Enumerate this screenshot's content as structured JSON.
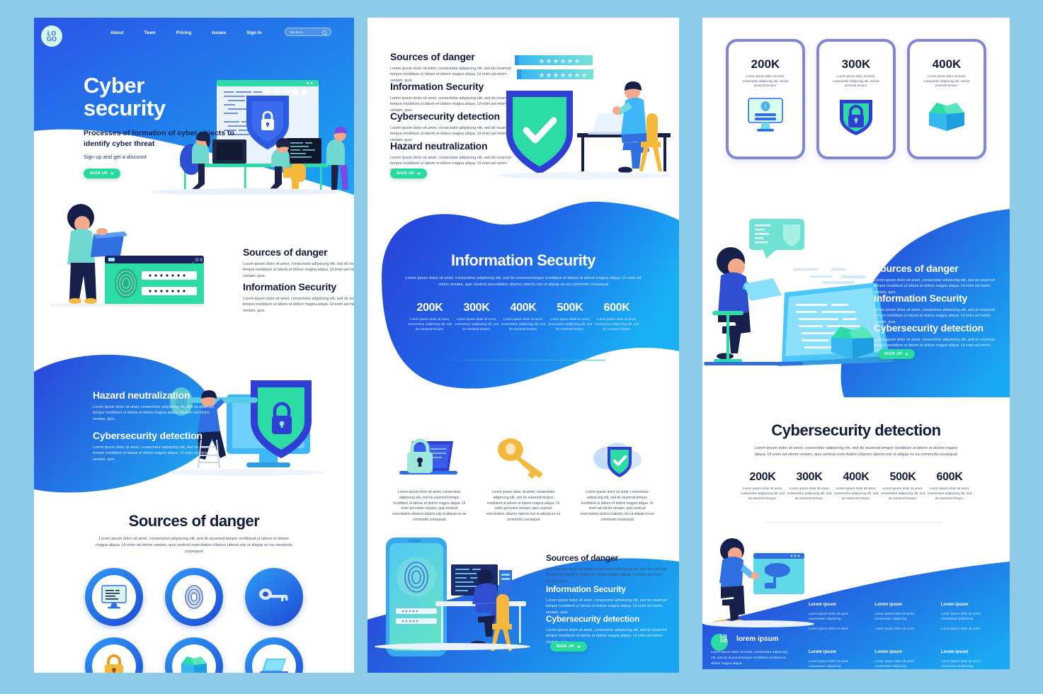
{
  "meta": {
    "background_color": "#8ecbe8",
    "accent_blue": "#1f49d6",
    "accent_cyan": "#18a8f0",
    "accent_green": "#27dba0",
    "text_dark": "#141c3a"
  },
  "lorem": {
    "short": "Lorem ipsum dolor sit amet, consectetur adipiscing elit, sed do eiusmod tempor incididunt ut labore et dolore magna aliqua. Ut enim ad minim veniam, quis.",
    "long": "Lorem ipsum dolor sit amet, consectetur adipiscing elit, sed do eiusmod tempor incididunt ut labore et dolore magna aliqua. Ut enim ad minim veniam, quis nostrud exercitation ullamco laboris nisi ut aliquip ex ea commodo consequat",
    "tiny": "Lorem ipsum dolor sit amet, consectetur adipiscing elit, sed do eiusmod tempor.",
    "icon_caption": "Lorem ipsum dolor sit amet, consectetur adipiscing elit, sed do eiusmod tempor incididunt ut labore et dolore magna aliqua. Ut enim ad minim veniam, quis nostrud exercitation ullamco laboris nisi ut aliquip ex ea commodo consequat",
    "footer_heading": "Lorem ipsum",
    "footer_line_1": "Lorem ipsum dolor sit amet, consectetur adipiscing",
    "footer_line_2": "Lorem ipsum dolor sit amet",
    "brand_tagline": "lorem ipsum",
    "brand_body": "Lorem ipsum dolor sit amet, consectetur adipiscing elit, sed do eiusmod tempor incididunt ut labore et dolore magna aliqua."
  },
  "panel1": {
    "nav": {
      "logo_line1": "LO",
      "logo_line2": "GO",
      "links": [
        "About",
        "Team",
        "Pricing",
        "Issues",
        "Sign In"
      ],
      "search_value": "Get More",
      "search_icon": "search-icon"
    },
    "hero": {
      "title_line1": "Cyber",
      "title_line2": "security",
      "subtitle": "Processes of formation of cyber objects to identify cyber threat",
      "note": "Sign up and get a discount",
      "cta": "SIGN UP"
    },
    "section_features": [
      {
        "title": "Sources of danger"
      },
      {
        "title": "Information Security"
      }
    ],
    "section_hazard": [
      {
        "title": "Hazard neutralization"
      },
      {
        "title": "Cybersecurity detection"
      }
    ],
    "section_icons": {
      "title": "Sources of danger",
      "icons": [
        "monitor-document-icon",
        "fingerprint-icon",
        "key-icon",
        "padlock-icon",
        "open-box-icon",
        "laptop-icon"
      ]
    }
  },
  "panel2": {
    "hero_features": [
      {
        "title": "Sources of danger"
      },
      {
        "title": "Information Security"
      },
      {
        "title": "Cybersecurity detection"
      },
      {
        "title": "Hazard neutralization"
      }
    ],
    "hero_cta": "SIGN UP",
    "stats_section": {
      "title": "Information Security",
      "stats": [
        {
          "value": "200K"
        },
        {
          "value": "300K"
        },
        {
          "value": "400K"
        },
        {
          "value": "500K"
        },
        {
          "value": "600K"
        }
      ]
    },
    "icon_row": [
      {
        "icon": "laptop-lock-icon"
      },
      {
        "icon": "key-icon"
      },
      {
        "icon": "cloud-shield-check-icon"
      }
    ],
    "bottom_features": [
      {
        "title": "Sources of danger"
      },
      {
        "title": "Information Security"
      },
      {
        "title": "Cybersecurity detection"
      }
    ],
    "bottom_cta": "SIGN UP"
  },
  "panel3": {
    "cards": [
      {
        "value": "200K",
        "icon": "monitor-login-icon"
      },
      {
        "value": "300K",
        "icon": "shield-lock-icon"
      },
      {
        "value": "400K",
        "icon": "open-box-icon"
      }
    ],
    "hero_features": [
      {
        "title": "Sources of danger"
      },
      {
        "title": "Information Security"
      },
      {
        "title": "Cybersecurity detection"
      }
    ],
    "hero_cta": "SIGN UP",
    "stats_section": {
      "title": "Cybersecurity detection",
      "stats": [
        {
          "value": "200K"
        },
        {
          "value": "300K"
        },
        {
          "value": "400K"
        },
        {
          "value": "500K"
        },
        {
          "value": "600K"
        }
      ]
    },
    "footer": {
      "brand_logo_line1": "LO",
      "brand_logo_line2": "GO",
      "columns": 6
    }
  }
}
